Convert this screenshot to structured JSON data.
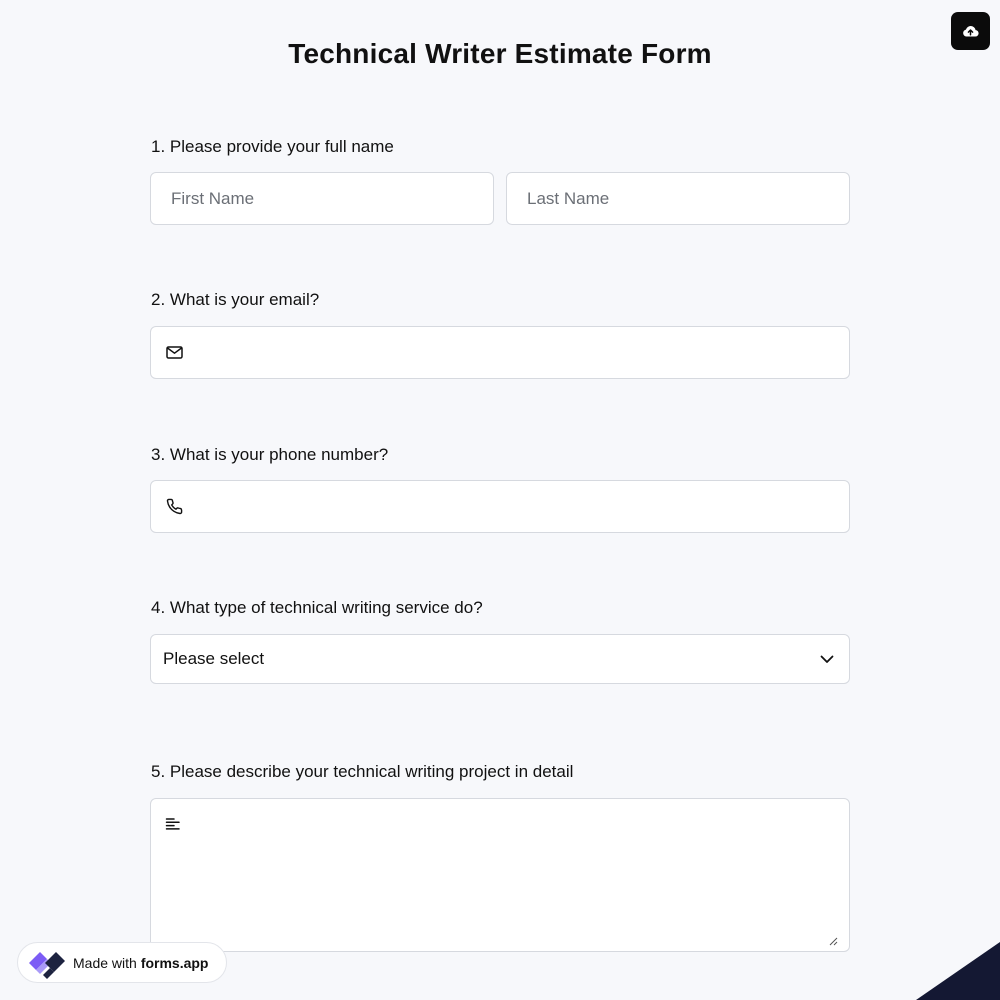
{
  "form": {
    "title": "Technical Writer Estimate Form"
  },
  "questions": {
    "q1": {
      "label": "1.  Please provide your full name",
      "first_name_placeholder": "First Name",
      "last_name_placeholder": "Last Name"
    },
    "q2": {
      "label": "2. What is your email?",
      "icon": "mail-icon",
      "value": ""
    },
    "q3": {
      "label": "3. What is your phone number?",
      "icon": "phone-icon",
      "value": ""
    },
    "q4": {
      "label": "4. What type of technical writing service do?",
      "selected": "Please select",
      "icon": "chevron-down-icon"
    },
    "q5": {
      "label": "5. Please describe your technical writing project in detail",
      "icon": "text-align-left-icon",
      "value": ""
    }
  },
  "badge": {
    "made_with": "Made with",
    "brand": "forms.app"
  },
  "toolbar": {
    "upload_icon": "cloud-upload-icon"
  },
  "colors": {
    "background": "#f7f8fb",
    "upload_button": "#0b0b0b",
    "field_border": "#d6d9df",
    "brand_purple": "#7c5cf5",
    "brand_dark": "#1d2340",
    "corner_navy": "#141833"
  }
}
